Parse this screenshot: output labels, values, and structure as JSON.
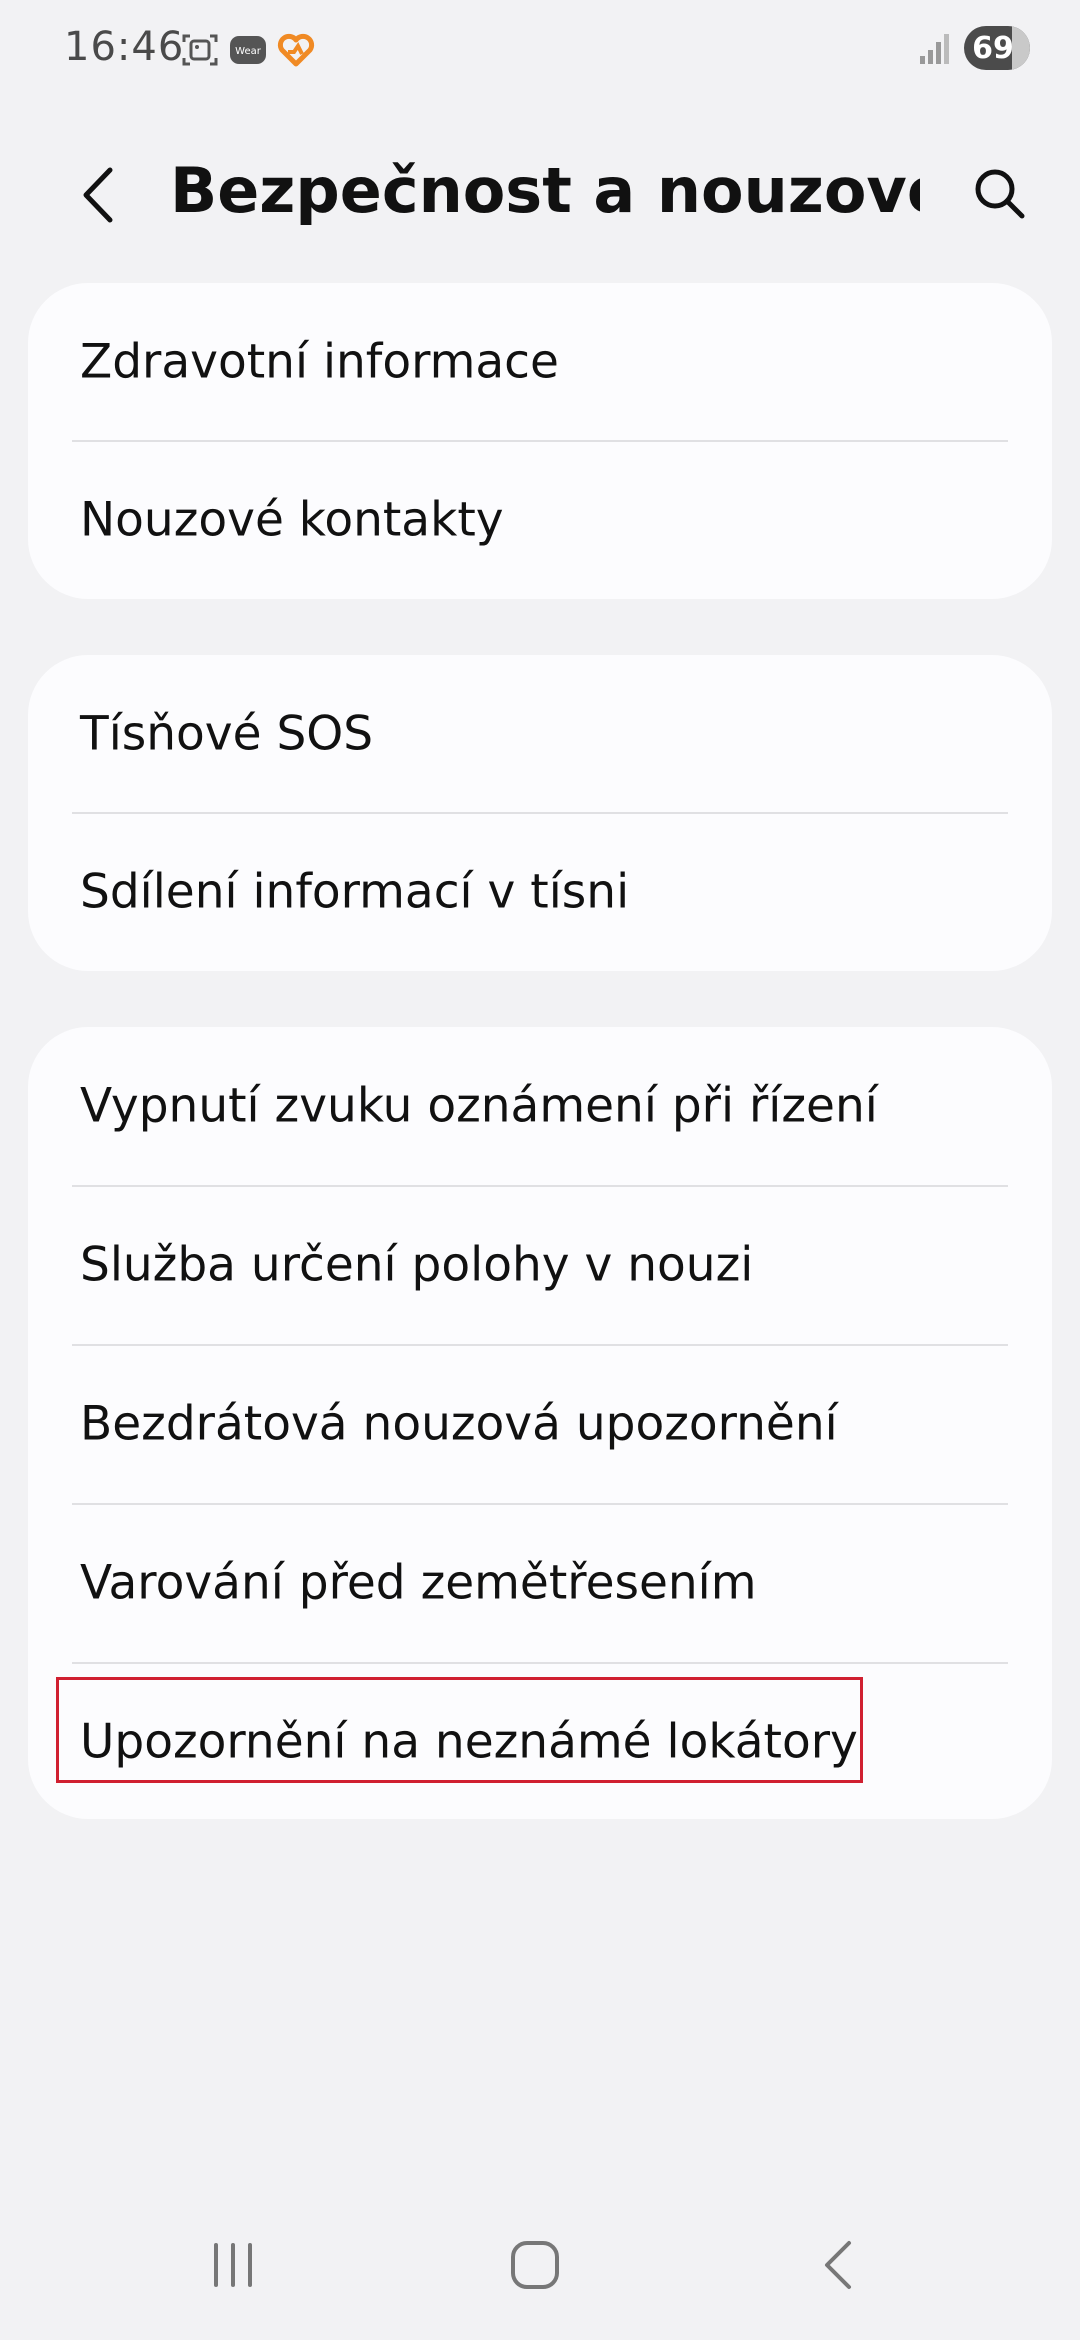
{
  "status_bar": {
    "time": "16:46",
    "battery": "69",
    "icons": [
      "gallery-icon",
      "wear-icon",
      "health-icon",
      "signal-icon"
    ]
  },
  "header": {
    "title": "Bezpečnost a nouzové...",
    "back_icon": "back-arrow-icon",
    "search_icon": "search-icon"
  },
  "groups": [
    {
      "items": [
        {
          "label": "Zdravotní informace"
        },
        {
          "label": "Nouzové kontakty"
        }
      ]
    },
    {
      "items": [
        {
          "label": "Tísňové SOS"
        },
        {
          "label": "Sdílení informací v tísni"
        }
      ]
    },
    {
      "items": [
        {
          "label": "Vypnutí zvuku oznámení při řízení"
        },
        {
          "label": "Služba určení polohy v nouzi"
        },
        {
          "label": "Bezdrátová nouzová upozornění"
        },
        {
          "label": "Varování před zemětřesením"
        },
        {
          "label": "Upozornění na neznámé lokátory"
        }
      ]
    }
  ],
  "highlight_color": "#d01f30",
  "nav_bar": {
    "icons": [
      "recents-icon",
      "home-icon",
      "back-icon"
    ]
  }
}
